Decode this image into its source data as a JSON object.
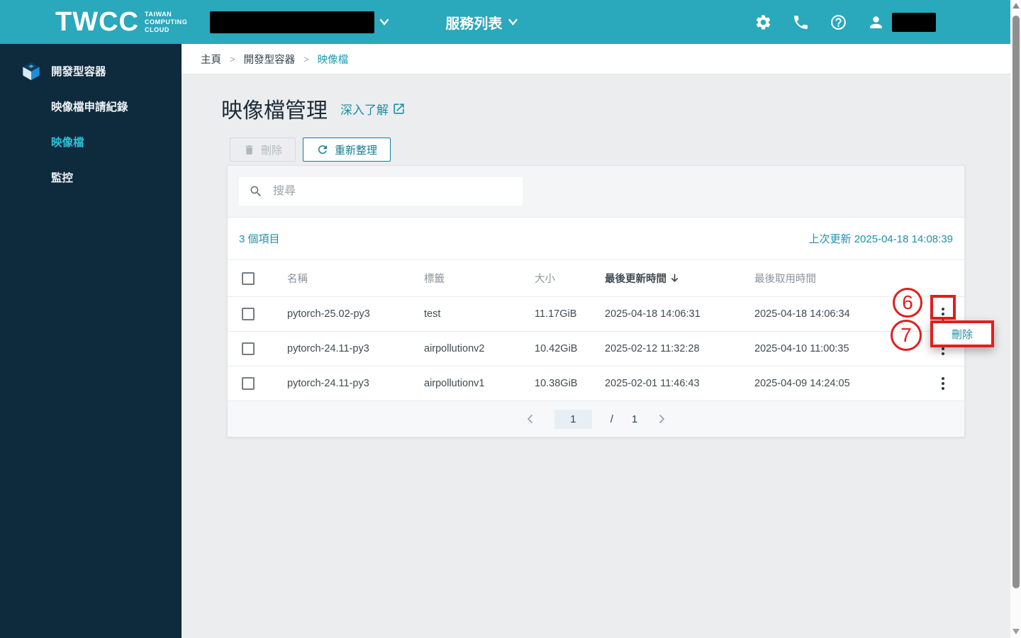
{
  "header": {
    "brand": "TWCC",
    "tagline": {
      "line1": "TAIWAN",
      "line2": "COMPUTING",
      "line3": "CLOUD"
    },
    "service_menu_label": "服務列表",
    "icons": [
      "settings-icon",
      "phone-icon",
      "help-icon",
      "user-icon"
    ]
  },
  "sidebar": {
    "items": [
      {
        "label": "開發型容器",
        "icon": "container-cube-icon",
        "active": false
      },
      {
        "label": "映像檔申請紀錄",
        "active": false
      },
      {
        "label": "映像檔",
        "active": true
      },
      {
        "label": "監控",
        "active": false
      }
    ]
  },
  "breadcrumb": {
    "separator": ">",
    "items": [
      "主頁",
      "開發型容器",
      "映像檔"
    ]
  },
  "page": {
    "title": "映像檔管理",
    "learn_more_label": "深入了解",
    "delete_button_label": "刪除",
    "refresh_button_label": "重新整理"
  },
  "table_card": {
    "search_placeholder": "搜尋",
    "item_count_text": "3 個項目",
    "last_updated_text": "上次更新 2025-04-18 14:08:39",
    "columns": {
      "name": "名稱",
      "tag": "標籤",
      "size": "大小",
      "updated": "最後更新時間",
      "accessed": "最後取用時間"
    },
    "sorted_column": "最後更新時間",
    "sort_direction": "desc",
    "rows": [
      {
        "name": "pytorch-25.02-py3",
        "tag": "test",
        "size": "11.17GiB",
        "updated": "2025-04-18 14:06:31",
        "accessed": "2025-04-18 14:06:34"
      },
      {
        "name": "pytorch-24.11-py3",
        "tag": "airpollutionv2",
        "size": "10.42GiB",
        "updated": "2025-02-12 11:32:28",
        "accessed": "2025-04-10 11:00:35"
      },
      {
        "name": "pytorch-24.11-py3",
        "tag": "airpollutionv1",
        "size": "10.38GiB",
        "updated": "2025-02-01 11:46:43",
        "accessed": "2025-04-09 14:24:05"
      }
    ],
    "pagination": {
      "current_page": "1",
      "separator": "/",
      "total_pages": "1"
    }
  },
  "annotations": {
    "step6_label": "6",
    "step7_label": "7",
    "menu_delete_label": "刪除",
    "highlight_color": "#e01f1f"
  },
  "colors": {
    "header_teal": "#2aa8bc",
    "sidebar_navy": "#0e2a3d",
    "accent_teal": "#1b90a5",
    "annotation_red": "#e01f1f"
  }
}
